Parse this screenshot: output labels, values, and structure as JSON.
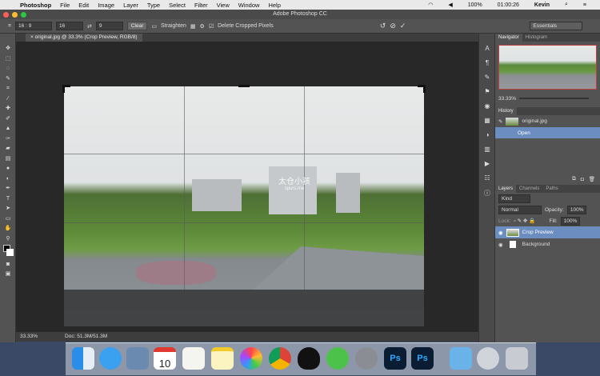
{
  "menubar": {
    "app": "Photoshop",
    "items": [
      "File",
      "Edit",
      "Image",
      "Layer",
      "Type",
      "Select",
      "Filter",
      "View",
      "Window",
      "Help"
    ],
    "battery": "100%",
    "time": "01:00:26",
    "user": "Kevin"
  },
  "window": {
    "title": "Adobe Photoshop CC"
  },
  "options": {
    "ratio": "16 : 9",
    "width": "16",
    "height": "9",
    "clear": "Clear",
    "straighten": "Straighten",
    "delete_cropped": "Delete Cropped Pixels",
    "workspace": "Essentials"
  },
  "document": {
    "tab": "original.jpg @ 33.3% (Crop Preview, RGB/8)",
    "watermark": "太仓小孩",
    "watermark_sub": "spurs.me"
  },
  "status": {
    "zoom": "33.33%",
    "doc": "Doc: 51.3M/51.3M"
  },
  "navigator": {
    "tabs": [
      "Navigator",
      "Histogram"
    ],
    "zoom": "33.33%"
  },
  "history": {
    "title": "History",
    "items": [
      "original.jpg",
      "Open"
    ]
  },
  "layers": {
    "tabs": [
      "Layers",
      "Channels",
      "Paths"
    ],
    "kind": "Kind",
    "blend": "Normal",
    "opacity_label": "Opacity:",
    "opacity": "100%",
    "lock_label": "Lock:",
    "fill_label": "Fill:",
    "fill": "100%",
    "items": [
      "Crop Preview",
      "Background"
    ]
  },
  "dock": {
    "calendar_day": "10",
    "calendar_month": "6月"
  }
}
